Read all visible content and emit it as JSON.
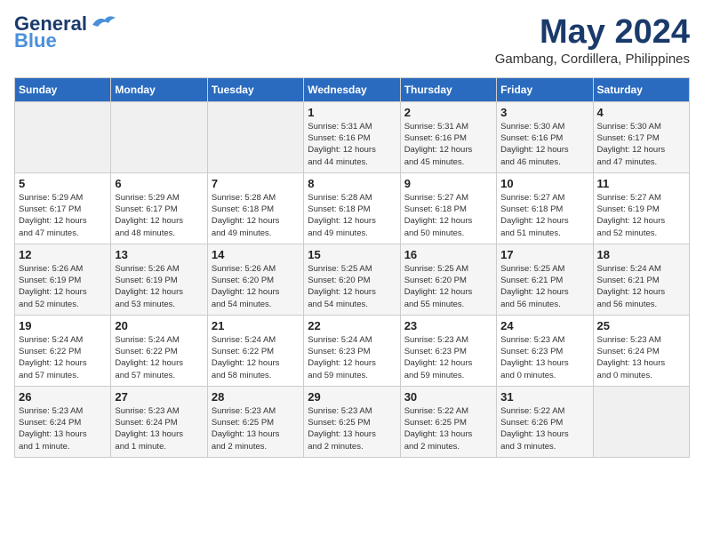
{
  "header": {
    "logo_line1": "General",
    "logo_line2": "Blue",
    "month": "May 2024",
    "location": "Gambang, Cordillera, Philippines"
  },
  "weekdays": [
    "Sunday",
    "Monday",
    "Tuesday",
    "Wednesday",
    "Thursday",
    "Friday",
    "Saturday"
  ],
  "weeks": [
    [
      {
        "day": "",
        "info": ""
      },
      {
        "day": "",
        "info": ""
      },
      {
        "day": "",
        "info": ""
      },
      {
        "day": "1",
        "info": "Sunrise: 5:31 AM\nSunset: 6:16 PM\nDaylight: 12 hours\nand 44 minutes."
      },
      {
        "day": "2",
        "info": "Sunrise: 5:31 AM\nSunset: 6:16 PM\nDaylight: 12 hours\nand 45 minutes."
      },
      {
        "day": "3",
        "info": "Sunrise: 5:30 AM\nSunset: 6:16 PM\nDaylight: 12 hours\nand 46 minutes."
      },
      {
        "day": "4",
        "info": "Sunrise: 5:30 AM\nSunset: 6:17 PM\nDaylight: 12 hours\nand 47 minutes."
      }
    ],
    [
      {
        "day": "5",
        "info": "Sunrise: 5:29 AM\nSunset: 6:17 PM\nDaylight: 12 hours\nand 47 minutes."
      },
      {
        "day": "6",
        "info": "Sunrise: 5:29 AM\nSunset: 6:17 PM\nDaylight: 12 hours\nand 48 minutes."
      },
      {
        "day": "7",
        "info": "Sunrise: 5:28 AM\nSunset: 6:18 PM\nDaylight: 12 hours\nand 49 minutes."
      },
      {
        "day": "8",
        "info": "Sunrise: 5:28 AM\nSunset: 6:18 PM\nDaylight: 12 hours\nand 49 minutes."
      },
      {
        "day": "9",
        "info": "Sunrise: 5:27 AM\nSunset: 6:18 PM\nDaylight: 12 hours\nand 50 minutes."
      },
      {
        "day": "10",
        "info": "Sunrise: 5:27 AM\nSunset: 6:18 PM\nDaylight: 12 hours\nand 51 minutes."
      },
      {
        "day": "11",
        "info": "Sunrise: 5:27 AM\nSunset: 6:19 PM\nDaylight: 12 hours\nand 52 minutes."
      }
    ],
    [
      {
        "day": "12",
        "info": "Sunrise: 5:26 AM\nSunset: 6:19 PM\nDaylight: 12 hours\nand 52 minutes."
      },
      {
        "day": "13",
        "info": "Sunrise: 5:26 AM\nSunset: 6:19 PM\nDaylight: 12 hours\nand 53 minutes."
      },
      {
        "day": "14",
        "info": "Sunrise: 5:26 AM\nSunset: 6:20 PM\nDaylight: 12 hours\nand 54 minutes."
      },
      {
        "day": "15",
        "info": "Sunrise: 5:25 AM\nSunset: 6:20 PM\nDaylight: 12 hours\nand 54 minutes."
      },
      {
        "day": "16",
        "info": "Sunrise: 5:25 AM\nSunset: 6:20 PM\nDaylight: 12 hours\nand 55 minutes."
      },
      {
        "day": "17",
        "info": "Sunrise: 5:25 AM\nSunset: 6:21 PM\nDaylight: 12 hours\nand 56 minutes."
      },
      {
        "day": "18",
        "info": "Sunrise: 5:24 AM\nSunset: 6:21 PM\nDaylight: 12 hours\nand 56 minutes."
      }
    ],
    [
      {
        "day": "19",
        "info": "Sunrise: 5:24 AM\nSunset: 6:22 PM\nDaylight: 12 hours\nand 57 minutes."
      },
      {
        "day": "20",
        "info": "Sunrise: 5:24 AM\nSunset: 6:22 PM\nDaylight: 12 hours\nand 57 minutes."
      },
      {
        "day": "21",
        "info": "Sunrise: 5:24 AM\nSunset: 6:22 PM\nDaylight: 12 hours\nand 58 minutes."
      },
      {
        "day": "22",
        "info": "Sunrise: 5:24 AM\nSunset: 6:23 PM\nDaylight: 12 hours\nand 59 minutes."
      },
      {
        "day": "23",
        "info": "Sunrise: 5:23 AM\nSunset: 6:23 PM\nDaylight: 12 hours\nand 59 minutes."
      },
      {
        "day": "24",
        "info": "Sunrise: 5:23 AM\nSunset: 6:23 PM\nDaylight: 13 hours\nand 0 minutes."
      },
      {
        "day": "25",
        "info": "Sunrise: 5:23 AM\nSunset: 6:24 PM\nDaylight: 13 hours\nand 0 minutes."
      }
    ],
    [
      {
        "day": "26",
        "info": "Sunrise: 5:23 AM\nSunset: 6:24 PM\nDaylight: 13 hours\nand 1 minute."
      },
      {
        "day": "27",
        "info": "Sunrise: 5:23 AM\nSunset: 6:24 PM\nDaylight: 13 hours\nand 1 minute."
      },
      {
        "day": "28",
        "info": "Sunrise: 5:23 AM\nSunset: 6:25 PM\nDaylight: 13 hours\nand 2 minutes."
      },
      {
        "day": "29",
        "info": "Sunrise: 5:23 AM\nSunset: 6:25 PM\nDaylight: 13 hours\nand 2 minutes."
      },
      {
        "day": "30",
        "info": "Sunrise: 5:22 AM\nSunset: 6:25 PM\nDaylight: 13 hours\nand 2 minutes."
      },
      {
        "day": "31",
        "info": "Sunrise: 5:22 AM\nSunset: 6:26 PM\nDaylight: 13 hours\nand 3 minutes."
      },
      {
        "day": "",
        "info": ""
      }
    ]
  ]
}
